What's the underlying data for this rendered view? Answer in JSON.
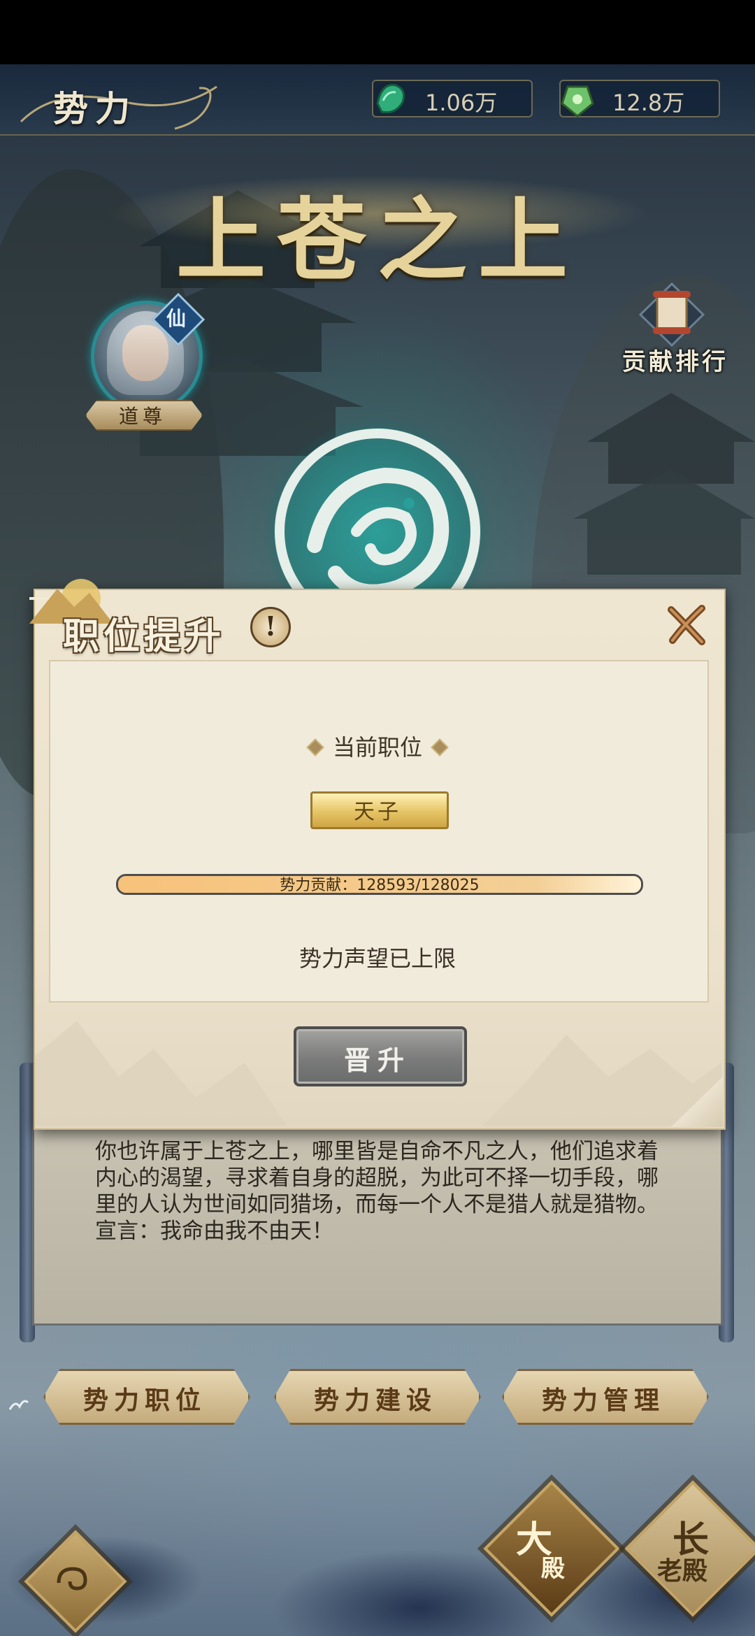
{
  "header": {
    "title": "势力",
    "currencies": [
      {
        "icon": "jade-gem-icon",
        "value": "1.06万"
      },
      {
        "icon": "jade-pendant-icon",
        "value": "12.8万"
      }
    ]
  },
  "faction": {
    "name": "上苍之上",
    "leader_title": "道尊",
    "leader_badge": "仙",
    "ranking_label": "贡献排行"
  },
  "modal": {
    "title": "职位提升",
    "current_position_label": "当前职位",
    "current_position": "天子",
    "progress": {
      "label_prefix": "势力贡献：",
      "current": 128593,
      "target": 128025,
      "text": "势力贡献：128593/128025",
      "fill_fraction": 1.0
    },
    "limit_text": "势力声望已上限",
    "promote_button": "晋升"
  },
  "description": "你也许属于上苍之上，哪里皆是自命不凡之人，他们追求着内心的渴望，寻求着自身的超脱，为此可不择一切手段，哪里的人认为世间如同猎场，而每一个人不是猎人就是猎物。  宣言：我命由我不由天！",
  "tabs": [
    {
      "label": "势力职位"
    },
    {
      "label": "势力建设"
    },
    {
      "label": "势力管理"
    }
  ],
  "bottom_buttons": [
    {
      "line1": "大",
      "line2": "殿"
    },
    {
      "line1": "长",
      "line2": "老殿"
    }
  ],
  "colors": {
    "gold": "#e5d39b",
    "teal": "#2a8c93",
    "parchment": "#efe6d2",
    "button_gray": "#7a7b7a"
  }
}
